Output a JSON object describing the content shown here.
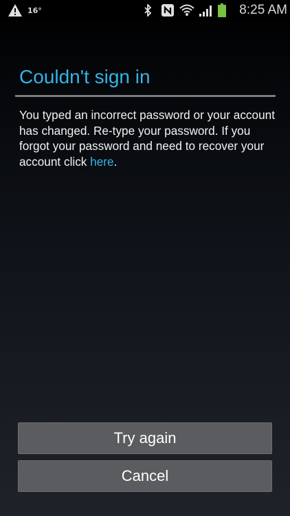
{
  "status_bar": {
    "temperature": "16°",
    "time": "8:25 AM",
    "icons": [
      "warning-icon",
      "bluetooth-icon",
      "nfc-icon",
      "wifi-icon",
      "signal-icon",
      "battery-icon"
    ],
    "battery_color": "#7ac143"
  },
  "dialog": {
    "title": "Couldn't sign in",
    "message_text": "You typed an incorrect password or your account has changed. Re-type your password. If you forgot your password and need to recover your account click ",
    "message_link": "here",
    "message_end": ".",
    "accent_color": "#33b5e5"
  },
  "buttons": {
    "try_again": "Try again",
    "cancel": "Cancel"
  }
}
